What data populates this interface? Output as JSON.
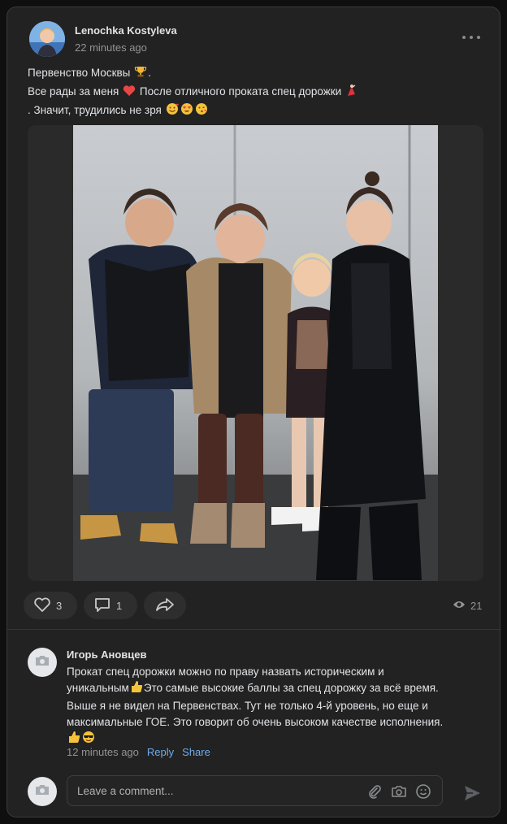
{
  "post": {
    "author": "Lenochka Kostyleva",
    "time": "22 minutes ago",
    "text_lines": [
      "Первенство Москвы",
      "Все рады за меня",
      "После отличного проката спец дорожки",
      ". Значит, трудились не зря"
    ],
    "text_suffix_1": ".",
    "emojis": [
      "trophy-emoji",
      "heart-emoji",
      "dancer-emoji",
      "smiling-hearts-emoji",
      "heart-eyes-emoji",
      "kiss-emoji"
    ]
  },
  "actions": {
    "likes": "3",
    "comments": "1",
    "views": "21"
  },
  "comment": {
    "author": "Игорь Ановцев",
    "lines": [
      "Прокат спец дорожки можно по праву назвать историческим и",
      "уникальным",
      "Это самые высокие баллы за спец дорожку за всё время.",
      "Выше я не видел на Первенствах. Тут не только 4-й уровень, но еще и",
      "максимальные ГОЕ. Это говорит об очень высоком качестве исполнения."
    ],
    "time": "12 minutes ago",
    "reply_label": "Reply",
    "share_label": "Share"
  },
  "composer": {
    "placeholder": "Leave a comment..."
  },
  "colors": {
    "background": "#222222",
    "accent_link": "#71aaeb",
    "muted": "#939393",
    "heart": "#e64646"
  }
}
